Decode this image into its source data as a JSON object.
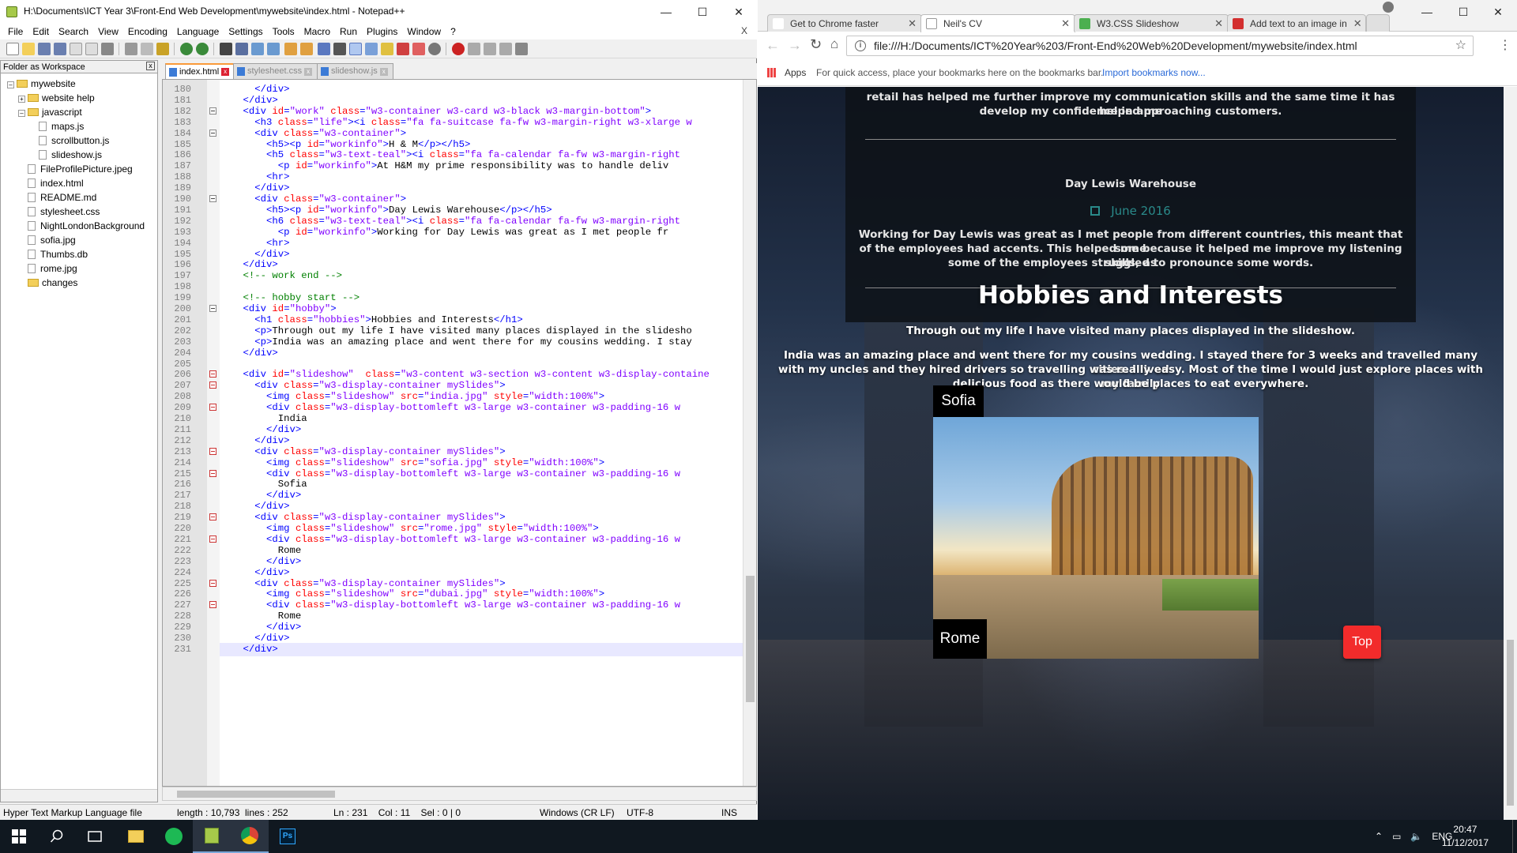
{
  "notepad": {
    "title": "H:\\Documents\\ICT Year 3\\Front-End Web Development\\mywebsite\\index.html - Notepad++",
    "menu": [
      "File",
      "Edit",
      "Search",
      "View",
      "Encoding",
      "Language",
      "Settings",
      "Tools",
      "Macro",
      "Run",
      "Plugins",
      "Window",
      "?"
    ],
    "menu_close": "X",
    "workspace_title": "Folder as Workspace",
    "tree": {
      "root": "mywebsite",
      "website_help": "website help",
      "javascript": "javascript",
      "maps": "maps.js",
      "scrollbutton": "scrollbutton.js",
      "slideshow": "slideshow.js",
      "fileprofile": "FileProfilePicture.jpeg",
      "index": "index.html",
      "readme": "README.md",
      "stylesheet": "stylesheet.css",
      "nightlondon": "NightLondonBackground",
      "sofia": "sofia.jpg",
      "thumbs": "Thumbs.db",
      "rome": "rome.jpg",
      "changes": "changes"
    },
    "tabs": [
      "index.html",
      "stylesheet.css",
      "slideshow.js"
    ],
    "status": {
      "filetype": "Hyper Text Markup Language file",
      "length": "length : 10,793",
      "lines": "lines : 252",
      "position": "Ln : 231    Col : 11    Sel : 0 | 0",
      "eol": "Windows (CR LF)",
      "encoding": "UTF-8",
      "mode": "INS"
    },
    "line_numbers": [
      "180",
      "181",
      "182",
      "183",
      "184",
      "185",
      "186",
      "187",
      "188",
      "189",
      "190",
      "191",
      "192",
      "193",
      "194",
      "195",
      "196",
      "197",
      "198",
      "199",
      "200",
      "201",
      "202",
      "203",
      "204",
      "205",
      "206",
      "207",
      "208",
      "209",
      "210",
      "211",
      "212",
      "213",
      "214",
      "215",
      "216",
      "217",
      "218",
      "219",
      "220",
      "221",
      "222",
      "223",
      "224",
      "225",
      "226",
      "227",
      "228",
      "229",
      "230",
      "231"
    ]
  },
  "code": [
    [
      [
        "t",
        "      </div>"
      ]
    ],
    [
      [
        "t",
        "    </div>"
      ]
    ],
    [
      [
        "t",
        "    <div "
      ],
      [
        "a",
        "id"
      ],
      [
        "t",
        "="
      ],
      [
        "v",
        "\"work\""
      ],
      [
        "t",
        " "
      ],
      [
        "a",
        "class"
      ],
      [
        "t",
        "="
      ],
      [
        "v",
        "\"w3-container w3-card w3-black w3-margin-bottom\""
      ],
      [
        "t",
        ">"
      ]
    ],
    [
      [
        "t",
        "      <h3 "
      ],
      [
        "a",
        "class"
      ],
      [
        "t",
        "="
      ],
      [
        "v",
        "\"life\""
      ],
      [
        "t",
        "><i "
      ],
      [
        "a",
        "class"
      ],
      [
        "t",
        "="
      ],
      [
        "v",
        "\"fa fa-suitcase fa-fw w3-margin-right w3-xlarge w"
      ]
    ],
    [
      [
        "t",
        "      <div "
      ],
      [
        "a",
        "class"
      ],
      [
        "t",
        "="
      ],
      [
        "v",
        "\"w3-container\""
      ],
      [
        "t",
        ">"
      ]
    ],
    [
      [
        "t",
        "        <h5><p "
      ],
      [
        "a",
        "id"
      ],
      [
        "t",
        "="
      ],
      [
        "v",
        "\"workinfo\""
      ],
      [
        "t",
        ">"
      ],
      [
        "x",
        "H & M"
      ],
      [
        "t",
        "</p></h5>"
      ]
    ],
    [
      [
        "t",
        "        <h5 "
      ],
      [
        "a",
        "class"
      ],
      [
        "t",
        "="
      ],
      [
        "v",
        "\"w3-text-teal\""
      ],
      [
        "t",
        "><i "
      ],
      [
        "a",
        "class"
      ],
      [
        "t",
        "="
      ],
      [
        "v",
        "\"fa fa-calendar fa-fw w3-margin-right"
      ]
    ],
    [
      [
        "t",
        "          <p "
      ],
      [
        "a",
        "id"
      ],
      [
        "t",
        "="
      ],
      [
        "v",
        "\"workinfo\""
      ],
      [
        "t",
        ">"
      ],
      [
        "x",
        "At H&M my prime responsibility was to handle deliv"
      ]
    ],
    [
      [
        "t",
        "        <hr>"
      ]
    ],
    [
      [
        "t",
        "      </div>"
      ]
    ],
    [
      [
        "t",
        "      <div "
      ],
      [
        "a",
        "class"
      ],
      [
        "t",
        "="
      ],
      [
        "v",
        "\"w3-container\""
      ],
      [
        "t",
        ">"
      ]
    ],
    [
      [
        "t",
        "        <h5><p "
      ],
      [
        "a",
        "id"
      ],
      [
        "t",
        "="
      ],
      [
        "v",
        "\"workinfo\""
      ],
      [
        "t",
        ">"
      ],
      [
        "x",
        "Day Lewis Warehouse"
      ],
      [
        "t",
        "</p></h5>"
      ]
    ],
    [
      [
        "t",
        "        <h6 "
      ],
      [
        "a",
        "class"
      ],
      [
        "t",
        "="
      ],
      [
        "v",
        "\"w3-text-teal\""
      ],
      [
        "t",
        "><i "
      ],
      [
        "a",
        "class"
      ],
      [
        "t",
        "="
      ],
      [
        "v",
        "\"fa fa-calendar fa-fw w3-margin-right"
      ]
    ],
    [
      [
        "t",
        "          <p "
      ],
      [
        "a",
        "id"
      ],
      [
        "t",
        "="
      ],
      [
        "v",
        "\"workinfo\""
      ],
      [
        "t",
        ">"
      ],
      [
        "x",
        "Working for Day Lewis was great as I met people fr"
      ]
    ],
    [
      [
        "t",
        "        <hr>"
      ]
    ],
    [
      [
        "t",
        "      </div>"
      ]
    ],
    [
      [
        "t",
        "    </div>"
      ]
    ],
    [
      [
        "c",
        "    <!-- work end -->"
      ]
    ],
    [
      [
        "x",
        ""
      ]
    ],
    [
      [
        "c",
        "    <!-- hobby start -->"
      ]
    ],
    [
      [
        "t",
        "    <div "
      ],
      [
        "a",
        "id"
      ],
      [
        "t",
        "="
      ],
      [
        "v",
        "\"hobby\""
      ],
      [
        "t",
        ">"
      ]
    ],
    [
      [
        "t",
        "      <h1 "
      ],
      [
        "a",
        "class"
      ],
      [
        "t",
        "="
      ],
      [
        "v",
        "\"hobbies\""
      ],
      [
        "t",
        ">"
      ],
      [
        "x",
        "Hobbies and Interests"
      ],
      [
        "t",
        "</h1>"
      ]
    ],
    [
      [
        "t",
        "      <p>"
      ],
      [
        "x",
        "Through out my life I have visited many places displayed in the slidesho"
      ]
    ],
    [
      [
        "t",
        "      <p>"
      ],
      [
        "x",
        "India was an amazing place and went there for my cousins wedding. I stay"
      ]
    ],
    [
      [
        "t",
        "    </div>"
      ]
    ],
    [
      [
        "x",
        ""
      ]
    ],
    [
      [
        "t",
        "    <div "
      ],
      [
        "a",
        "id"
      ],
      [
        "t",
        "="
      ],
      [
        "v",
        "\"slideshow\""
      ],
      [
        "t",
        "  "
      ],
      [
        "a",
        "class"
      ],
      [
        "t",
        "="
      ],
      [
        "v",
        "\"w3-content w3-section w3-content w3-display-containe"
      ]
    ],
    [
      [
        "t",
        "      <div "
      ],
      [
        "a",
        "class"
      ],
      [
        "t",
        "="
      ],
      [
        "v",
        "\"w3-display-container mySlides\""
      ],
      [
        "t",
        ">"
      ]
    ],
    [
      [
        "t",
        "        <img "
      ],
      [
        "a",
        "class"
      ],
      [
        "t",
        "="
      ],
      [
        "v",
        "\"slideshow\""
      ],
      [
        "t",
        " "
      ],
      [
        "a",
        "src"
      ],
      [
        "t",
        "="
      ],
      [
        "v",
        "\"india.jpg\""
      ],
      [
        "t",
        " "
      ],
      [
        "a",
        "style"
      ],
      [
        "t",
        "="
      ],
      [
        "v",
        "\"width:100%\""
      ],
      [
        "t",
        ">"
      ]
    ],
    [
      [
        "t",
        "        <div "
      ],
      [
        "a",
        "class"
      ],
      [
        "t",
        "="
      ],
      [
        "v",
        "\"w3-display-bottomleft w3-large w3-container w3-padding-16 w"
      ]
    ],
    [
      [
        "x",
        "          India"
      ]
    ],
    [
      [
        "t",
        "        </div>"
      ]
    ],
    [
      [
        "t",
        "      </div>"
      ]
    ],
    [
      [
        "t",
        "      <div "
      ],
      [
        "a",
        "class"
      ],
      [
        "t",
        "="
      ],
      [
        "v",
        "\"w3-display-container mySlides\""
      ],
      [
        "t",
        ">"
      ]
    ],
    [
      [
        "t",
        "        <img "
      ],
      [
        "a",
        "class"
      ],
      [
        "t",
        "="
      ],
      [
        "v",
        "\"slideshow\""
      ],
      [
        "t",
        " "
      ],
      [
        "a",
        "src"
      ],
      [
        "t",
        "="
      ],
      [
        "v",
        "\"sofia.jpg\""
      ],
      [
        "t",
        " "
      ],
      [
        "a",
        "style"
      ],
      [
        "t",
        "="
      ],
      [
        "v",
        "\"width:100%\""
      ],
      [
        "t",
        ">"
      ]
    ],
    [
      [
        "t",
        "        <div "
      ],
      [
        "a",
        "class"
      ],
      [
        "t",
        "="
      ],
      [
        "v",
        "\"w3-display-bottomleft w3-large w3-container w3-padding-16 w"
      ]
    ],
    [
      [
        "x",
        "          Sofia"
      ]
    ],
    [
      [
        "t",
        "        </div>"
      ]
    ],
    [
      [
        "t",
        "      </div>"
      ]
    ],
    [
      [
        "t",
        "      <div "
      ],
      [
        "a",
        "class"
      ],
      [
        "t",
        "="
      ],
      [
        "v",
        "\"w3-display-container mySlides\""
      ],
      [
        "t",
        ">"
      ]
    ],
    [
      [
        "t",
        "        <img "
      ],
      [
        "a",
        "class"
      ],
      [
        "t",
        "="
      ],
      [
        "v",
        "\"slideshow\""
      ],
      [
        "t",
        " "
      ],
      [
        "a",
        "src"
      ],
      [
        "t",
        "="
      ],
      [
        "v",
        "\"rome.jpg\""
      ],
      [
        "t",
        " "
      ],
      [
        "a",
        "style"
      ],
      [
        "t",
        "="
      ],
      [
        "v",
        "\"width:100%\""
      ],
      [
        "t",
        ">"
      ]
    ],
    [
      [
        "t",
        "        <div "
      ],
      [
        "a",
        "class"
      ],
      [
        "t",
        "="
      ],
      [
        "v",
        "\"w3-display-bottomleft w3-large w3-container w3-padding-16 w"
      ]
    ],
    [
      [
        "x",
        "          Rome"
      ]
    ],
    [
      [
        "t",
        "        </div>"
      ]
    ],
    [
      [
        "t",
        "      </div>"
      ]
    ],
    [
      [
        "t",
        "      <div "
      ],
      [
        "a",
        "class"
      ],
      [
        "t",
        "="
      ],
      [
        "v",
        "\"w3-display-container mySlides\""
      ],
      [
        "t",
        ">"
      ]
    ],
    [
      [
        "t",
        "        <img "
      ],
      [
        "a",
        "class"
      ],
      [
        "t",
        "="
      ],
      [
        "v",
        "\"slideshow\""
      ],
      [
        "t",
        " "
      ],
      [
        "a",
        "src"
      ],
      [
        "t",
        "="
      ],
      [
        "v",
        "\"dubai.jpg\""
      ],
      [
        "t",
        " "
      ],
      [
        "a",
        "style"
      ],
      [
        "t",
        "="
      ],
      [
        "v",
        "\"width:100%\""
      ],
      [
        "t",
        ">"
      ]
    ],
    [
      [
        "t",
        "        <div "
      ],
      [
        "a",
        "class"
      ],
      [
        "t",
        "="
      ],
      [
        "v",
        "\"w3-display-bottomleft w3-large w3-container w3-padding-16 w"
      ]
    ],
    [
      [
        "x",
        "          Rome"
      ]
    ],
    [
      [
        "t",
        "        </div>"
      ]
    ],
    [
      [
        "t",
        "      </div>"
      ]
    ],
    [
      [
        "t",
        "    </div>"
      ]
    ]
  ],
  "chrome": {
    "tabs": [
      "Get to Chrome faster",
      "Neil's CV",
      "W3.CSS Slideshow",
      "Add text to an image in"
    ],
    "url": "file:///H:/Documents/ICT%20Year%203/Front-End%20Web%20Development/mywebsite/index.html",
    "apps_label": "Apps",
    "bookmarks_hint": "For quick access, place your bookmarks here on the bookmarks bar.",
    "import_link": "Import bookmarks now..."
  },
  "page": {
    "retail_text_1": "retail has helped me further improve my communication skills and the same time it has helped me",
    "retail_text_2": "develop my confidence in approaching customers.",
    "job_title": "Day Lewis Warehouse",
    "job_date": "June 2016",
    "job_desc_1": "Working for Day Lewis was great as I met people from different countries, this meant that some",
    "job_desc_2": "of the employees had accents. This helped me because it helped me improve my listening skills, as",
    "job_desc_3": "some of the employees struggled to pronounce some words.",
    "hobbies_title": "Hobbies and Interests",
    "hobbies_p1": "Through out my life I have visited many places displayed in the slideshow.",
    "hobbies_p2_1": "India was an amazing place and went there for my cousins wedding. I stayed there for 3 weeks and travelled many cities. I lived",
    "hobbies_p2_2": "with my uncles and they hired drivers so travelling was really easy. Most of the time I would just explore places with my family",
    "hobbies_p2_3": "delicious food as there would be places to eat everywhere.",
    "slide_sofia": "Sofia",
    "slide_rome": "Rome",
    "top_button": "Top"
  },
  "taskbar": {
    "lang": "ENG",
    "time": "20:47",
    "date": "11/12/2017"
  },
  "colors": {
    "accent_tab": "#fa9a3a",
    "top_button": "#f22b2b",
    "teal_date": "#2a8a8a"
  }
}
